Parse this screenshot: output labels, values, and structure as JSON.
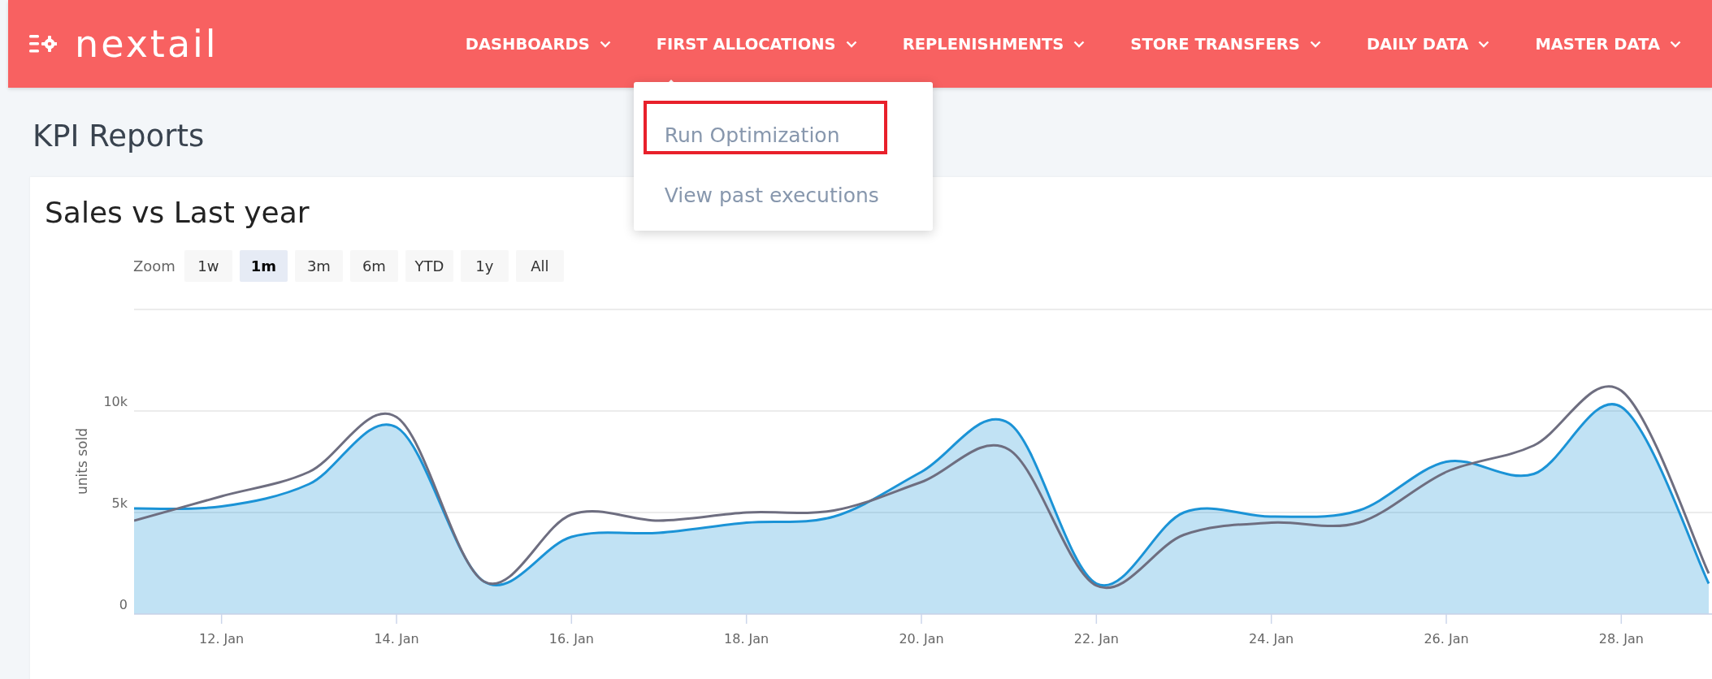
{
  "logo": {
    "text": "nextail"
  },
  "nav": [
    {
      "label": "DASHBOARDS",
      "expanded": false
    },
    {
      "label": "FIRST ALLOCATIONS",
      "expanded": true,
      "menu": [
        {
          "label": "Run Optimization",
          "highlighted": true
        },
        {
          "label": "View past executions",
          "highlighted": false
        }
      ]
    },
    {
      "label": "REPLENISHMENTS",
      "expanded": false
    },
    {
      "label": "STORE TRANSFERS",
      "expanded": false
    },
    {
      "label": "DAILY DATA",
      "expanded": false
    },
    {
      "label": "MASTER DATA",
      "expanded": false
    }
  ],
  "page_title": "KPI Reports",
  "chart": {
    "title": "Sales vs Last year",
    "zoom_label": "Zoom",
    "zoom_buttons": [
      {
        "label": "1w",
        "selected": false
      },
      {
        "label": "1m",
        "selected": true
      },
      {
        "label": "3m",
        "selected": false
      },
      {
        "label": "6m",
        "selected": false
      },
      {
        "label": "YTD",
        "selected": false
      },
      {
        "label": "1y",
        "selected": false
      },
      {
        "label": "All",
        "selected": false
      }
    ],
    "chart_data": {
      "type": "area",
      "ylabel": "units sold",
      "categories": [
        null,
        "12. Jan",
        null,
        "14. Jan",
        null,
        "16. Jan",
        null,
        "18. Jan",
        null,
        "20. Jan",
        null,
        "22. Jan",
        null,
        "24. Jan",
        null,
        "26. Jan",
        null,
        "28. Jan",
        null
      ],
      "series": [
        {
          "type": "area",
          "color": "#1b93d6",
          "values": [
            5200,
            5300,
            6400,
            9200,
            1600,
            3800,
            4000,
            4500,
            4800,
            7000,
            9400,
            1500,
            5000,
            4800,
            5100,
            7500,
            6900,
            10200,
            1500
          ]
        },
        {
          "type": "line",
          "color": "#6e6e80",
          "values": [
            4600,
            5800,
            7000,
            9700,
            1600,
            4900,
            4600,
            5000,
            5100,
            6500,
            8100,
            1400,
            3900,
            4500,
            4500,
            7000,
            8300,
            11000,
            2000
          ]
        }
      ],
      "ylim": [
        0,
        15000
      ],
      "yticks": [
        {
          "value": 0,
          "label": "0"
        },
        {
          "value": 5000,
          "label": "5k"
        },
        {
          "value": 10000,
          "label": "10k"
        }
      ]
    }
  }
}
